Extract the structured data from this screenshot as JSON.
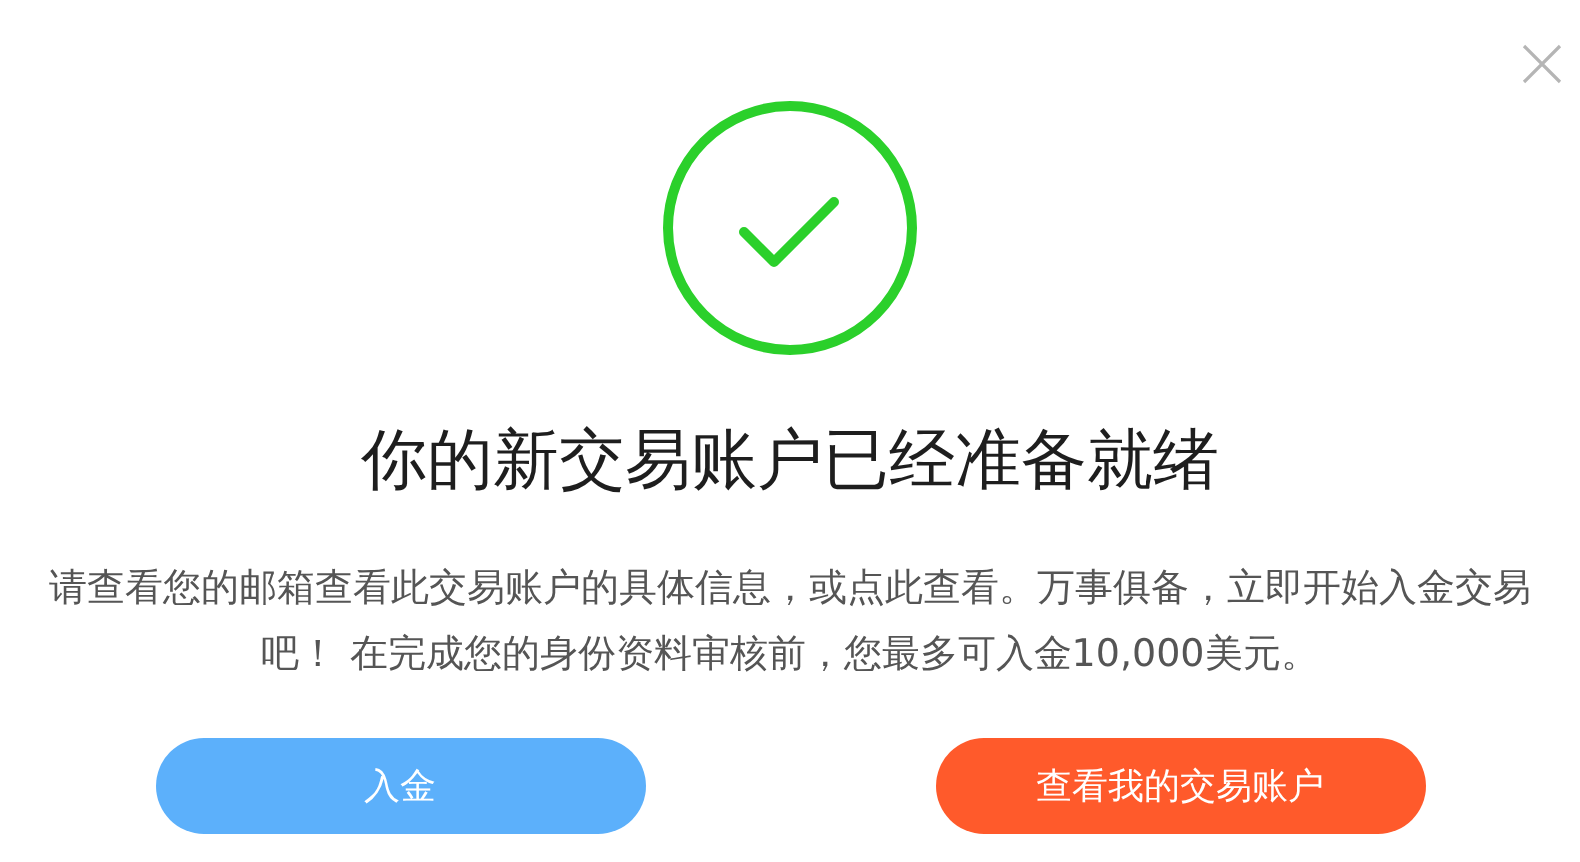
{
  "dialog": {
    "title": "你的新交易账户已经准备就绪",
    "message": "请查看您的邮箱查看此交易账户的具体信息，或点此查看。万事俱备，立即开始入金交易吧！ 在完成您的身份资料审核前，您最多可入金10,000美元。",
    "buttons": [
      {
        "label": "入金",
        "kind": "secondary"
      },
      {
        "label": "查看我的交易账户",
        "kind": "primary"
      }
    ]
  }
}
